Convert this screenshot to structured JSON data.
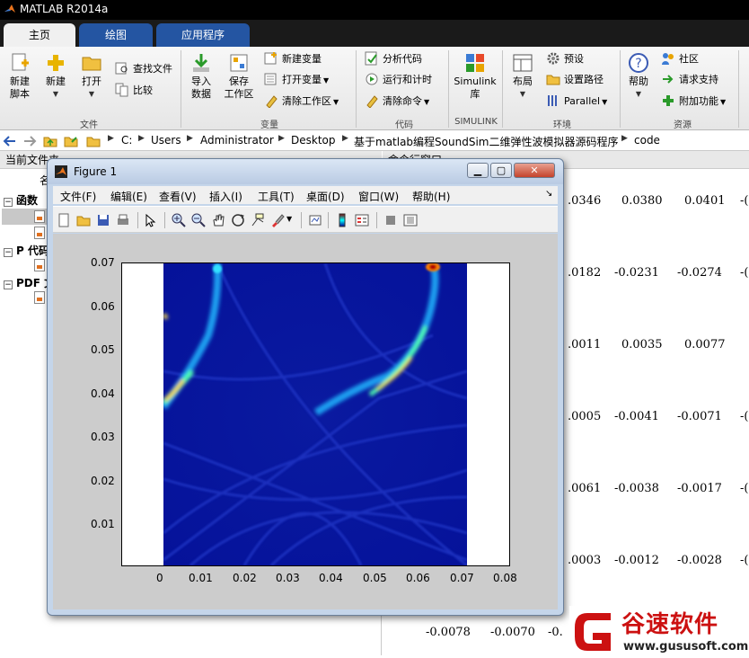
{
  "app": {
    "title": "MATLAB R2014a"
  },
  "tabs": [
    {
      "label": "主页",
      "active": true
    },
    {
      "label": "绘图",
      "active": false
    },
    {
      "label": "应用程序",
      "active": false
    }
  ],
  "ribbon": {
    "file": {
      "new_script": "新建\n脚本",
      "new": "新建",
      "open": "打开",
      "find_files": "查找文件",
      "compare": "比较",
      "group": "文件"
    },
    "variable": {
      "import": "导入\n数据",
      "save_ws": "保存\n工作区",
      "new_var": "新建变量",
      "open_var": "打开变量",
      "clear_ws": "清除工作区",
      "group": "变量"
    },
    "code": {
      "analyze": "分析代码",
      "run_time": "运行和计时",
      "clear_cmd": "清除命令",
      "group": "代码"
    },
    "simulink": {
      "label": "Simulink\n库",
      "group": "SIMULINK"
    },
    "env": {
      "layout": "布局",
      "prefs": "预设",
      "set_path": "设置路径",
      "parallel": "Parallel",
      "group": "环境"
    },
    "resources": {
      "help": "帮助",
      "community": "社区",
      "request_support": "请求支持",
      "addons": "附加功能",
      "group": "资源"
    }
  },
  "address": {
    "crumbs": [
      "C:",
      "Users",
      "Administrator",
      "Desktop",
      "基于matlab编程SoundSim二维弹性波模拟器源码程序",
      "code"
    ]
  },
  "left_panel": {
    "header": "当前文件夹",
    "col_name": "名",
    "sections": [
      "函数",
      "P 代码",
      "PDF 文"
    ]
  },
  "cmd": {
    "header": "命令行窗口",
    "rows": [
      [
        ".0346",
        "0.0380",
        "0.0401"
      ],
      [
        ".0182",
        "-0.0231",
        "-0.0274"
      ],
      [
        ".0011",
        "0.0035",
        "0.0077"
      ],
      [
        ".0005",
        "-0.0041",
        "-0.0071"
      ],
      [
        ".0061",
        "-0.0038",
        "-0.0017"
      ],
      [
        ".0003",
        "-0.0012",
        "-0.0028"
      ]
    ],
    "bottom_row": [
      "-0.0078",
      "-0.0070",
      "-0."
    ],
    "edge_marks": [
      "-(",
      "-(",
      "-(",
      "-(",
      "-(",
      "-("
    ]
  },
  "figure": {
    "title": "Figure 1",
    "menu": [
      "文件(F)",
      "编辑(E)",
      "查看(V)",
      "插入(I)",
      "工具(T)",
      "桌面(D)",
      "窗口(W)",
      "帮助(H)"
    ],
    "toolbar_icons": [
      "new-figure-icon",
      "open-file-icon",
      "save-icon",
      "print-icon",
      "arrow-select-icon",
      "zoom-in-icon",
      "zoom-out-icon",
      "pan-hand-icon",
      "rotate-3d-icon",
      "data-cursor-icon",
      "brush-icon",
      "link-plot-icon",
      "colorbar-icon",
      "legend-icon",
      "hide-plot-tools-icon",
      "show-plot-tools-icon"
    ]
  },
  "chart_data": {
    "type": "heatmap",
    "title": "",
    "xlabel": "",
    "ylabel": "",
    "xlim": [
      0,
      0.08
    ],
    "ylim": [
      0,
      0.07
    ],
    "xticks": [
      "0",
      "0.01",
      "0.02",
      "0.03",
      "0.04",
      "0.05",
      "0.06",
      "0.07",
      "0.08"
    ],
    "yticks": [
      "0.01",
      "0.02",
      "0.03",
      "0.04",
      "0.05",
      "0.06",
      "0.07"
    ],
    "image_extent": {
      "x": [
        0.0,
        0.07
      ],
      "y": [
        0.0,
        0.07
      ]
    },
    "colormap": "jet",
    "features": [
      {
        "name": "wavefront-right",
        "center": [
          0.062,
          0.07
        ],
        "radius": 0.038,
        "peak": 0.8
      },
      {
        "name": "wavefront-left",
        "center": [
          0.0,
          0.072
        ],
        "radius": 0.032,
        "peak": 0.85
      }
    ]
  },
  "watermark": {
    "brand": "谷速软件",
    "url": "www.gususoft.com",
    "color": "#cc1111"
  }
}
